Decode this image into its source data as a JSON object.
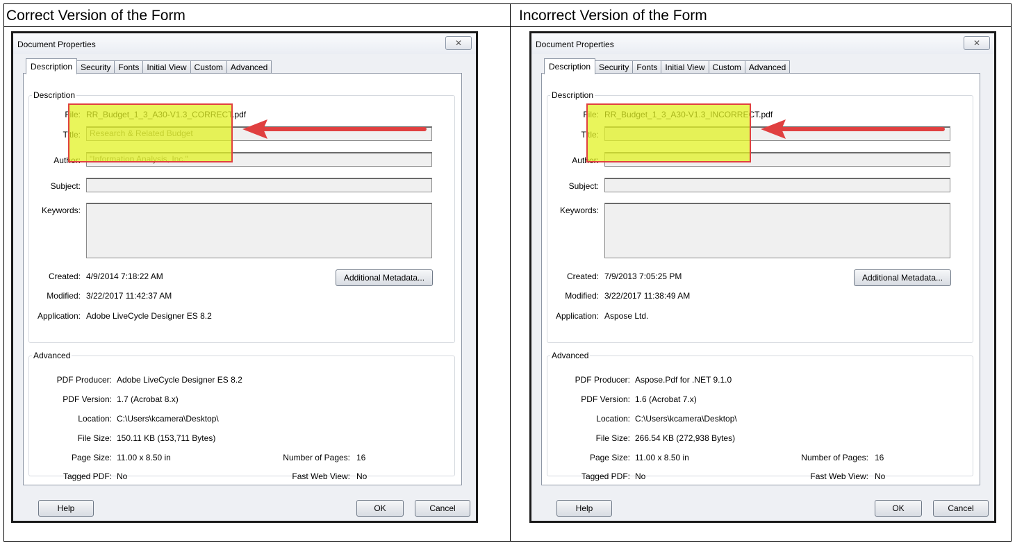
{
  "page": {
    "left_title": "Correct Version of the Form",
    "right_title": "Incorrect Version of the Form"
  },
  "dialogs": [
    {
      "window_title": "Document Properties",
      "close_glyph": "✕",
      "tabs": [
        "Description",
        "Security",
        "Fonts",
        "Initial View",
        "Custom",
        "Advanced"
      ],
      "active_tab": "Description",
      "description": {
        "group_label": "Description",
        "file_label": "File:",
        "file_value": "RR_Budget_1_3_A30-V1.3_CORRECT.pdf",
        "title_label": "Title:",
        "title_value": "Research & Related Budget",
        "author_label": "Author:",
        "author_value": "\"Information Analysis, Inc.\"",
        "subject_label": "Subject:",
        "subject_value": "",
        "keywords_label": "Keywords:",
        "keywords_value": "",
        "created_label": "Created:",
        "created_value": "4/9/2014 7:18:22 AM",
        "modified_label": "Modified:",
        "modified_value": "3/22/2017 11:42:37 AM",
        "application_label": "Application:",
        "application_value": "Adobe LiveCycle Designer ES 8.2",
        "metadata_button": "Additional Metadata..."
      },
      "advanced": {
        "group_label": "Advanced",
        "producer_label": "PDF Producer:",
        "producer_value": "Adobe LiveCycle Designer ES 8.2",
        "version_label": "PDF Version:",
        "version_value": "1.7 (Acrobat 8.x)",
        "location_label": "Location:",
        "location_value": "C:\\Users\\kcamera\\Desktop\\",
        "filesize_label": "File Size:",
        "filesize_value": "150.11 KB (153,711 Bytes)",
        "pagesize_label": "Page Size:",
        "pagesize_value": "11.00 x 8.50 in",
        "pages_label": "Number of Pages:",
        "pages_value": "16",
        "tagged_label": "Tagged PDF:",
        "tagged_value": "No",
        "fastweb_label": "Fast Web View:",
        "fastweb_value": "No"
      },
      "buttons": {
        "help": "Help",
        "ok": "OK",
        "cancel": "Cancel"
      },
      "annotation_color": "#e04040",
      "highlight_color": "#e2f224"
    },
    {
      "window_title": "Document Properties",
      "close_glyph": "✕",
      "tabs": [
        "Description",
        "Security",
        "Fonts",
        "Initial View",
        "Custom",
        "Advanced"
      ],
      "active_tab": "Description",
      "description": {
        "group_label": "Description",
        "file_label": "File:",
        "file_value": "RR_Budget_1_3_A30-V1.3_INCORRECT.pdf",
        "title_label": "Title:",
        "title_value": "",
        "author_label": "Author:",
        "author_value": "",
        "subject_label": "Subject:",
        "subject_value": "",
        "keywords_label": "Keywords:",
        "keywords_value": "",
        "created_label": "Created:",
        "created_value": "7/9/2013 7:05:25 PM",
        "modified_label": "Modified:",
        "modified_value": "3/22/2017 11:38:49 AM",
        "application_label": "Application:",
        "application_value": "Aspose Ltd.",
        "metadata_button": "Additional Metadata..."
      },
      "advanced": {
        "group_label": "Advanced",
        "producer_label": "PDF Producer:",
        "producer_value": "Aspose.Pdf for .NET 9.1.0",
        "version_label": "PDF Version:",
        "version_value": "1.6 (Acrobat 7.x)",
        "location_label": "Location:",
        "location_value": "C:\\Users\\kcamera\\Desktop\\",
        "filesize_label": "File Size:",
        "filesize_value": "266.54 KB (272,938 Bytes)",
        "pagesize_label": "Page Size:",
        "pagesize_value": "11.00 x 8.50 in",
        "pages_label": "Number of Pages:",
        "pages_value": "16",
        "tagged_label": "Tagged PDF:",
        "tagged_value": "No",
        "fastweb_label": "Fast Web View:",
        "fastweb_value": "No"
      },
      "buttons": {
        "help": "Help",
        "ok": "OK",
        "cancel": "Cancel"
      },
      "annotation_color": "#e04040",
      "highlight_color": "#e2f224"
    }
  ]
}
